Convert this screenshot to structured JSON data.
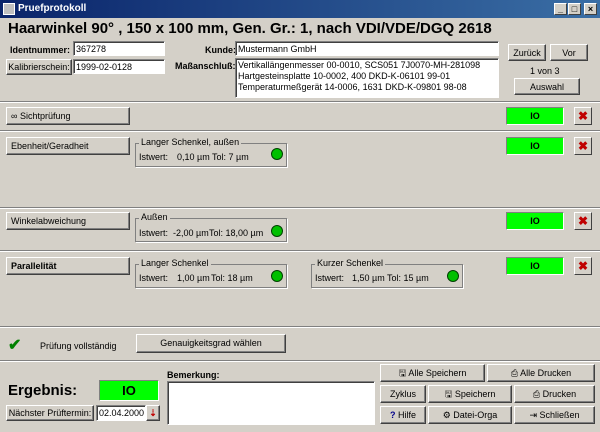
{
  "window": {
    "title": "Pruefprotokoll"
  },
  "heading": "Haarwinkel 90° , 150 x 100 mm, Gen. Gr.: 1, nach VDI/VDE/DGQ 2618",
  "header": {
    "ident_label": "Identnummer:",
    "ident_value": "367278",
    "calib_button": "Kalibrierschein:",
    "calib_value": "1999-02-0128",
    "kunde_label": "Kunde:",
    "kunde_value": "Mustermann GmbH",
    "masseinschluss_label": "Maßanschluß:",
    "masseinschluss_lines": [
      "Vertikallängenmesser 00-0010, SCS051 7J0070-MH-281098",
      "Hartgesteinsplatte 10-0002, 400 DKD-K-06101 99-01",
      "Temperaturmeßgerät 14-0006, 1631 DKD-K-09801 98-08"
    ],
    "back_button": "Zurück",
    "next_button": "Vor",
    "counter": "1 von 3",
    "select_button": "Auswahl"
  },
  "checks": {
    "sicht": {
      "label": "Sichtprüfung",
      "status": "IO"
    },
    "ebenheit": {
      "label": "Ebenheit/Geradheit",
      "status": "IO",
      "group_title": "Langer Schenkel, außen",
      "istwert_label": "Istwert:",
      "istwert": "0,10 µm",
      "tol": "Tol: 7 µm"
    },
    "winkel": {
      "label": "Winkelabweichung",
      "status": "IO",
      "group_title": "Außen",
      "istwert_label": "Istwert:",
      "istwert": "-2,00 µm",
      "tol": "Tol: 18,00 µm"
    },
    "parallel": {
      "label": "Parallelität",
      "status": "IO",
      "group1_title": "Langer Schenkel",
      "istwert1_label": "Istwert:",
      "istwert1": "1,00 µm",
      "tol1": "Tol: 18 µm",
      "group2_title": "Kurzer Schenkel",
      "istwert2_label": "Istwert:",
      "istwert2": "1,50 µm",
      "tol2": "Tol: 15 µm"
    }
  },
  "status": {
    "complete_text": "Prüfung vollständig",
    "accuracy_button": "Genauigkeitsgrad wählen"
  },
  "footer": {
    "ergebnis_label": "Ergebnis:",
    "ergebnis_value": "IO",
    "next_test_button": "Nächster Prüftermin:",
    "next_test_date": "02.04.2000",
    "bemerkung_label": "Bemerkung:",
    "buttons": {
      "save_all": "Alle Speichern",
      "print_all": "Alle Drucken",
      "zyklus": "Zyklus",
      "save": "Speichern",
      "print": "Drucken",
      "help": "Hilfe",
      "file_org": "Datei-Orga",
      "close": "Schließen"
    }
  },
  "colors": {
    "title_bar": "#0a246a",
    "io_green": "#00ff00",
    "led_green": "#00c000",
    "delete_red": "#c00000"
  }
}
